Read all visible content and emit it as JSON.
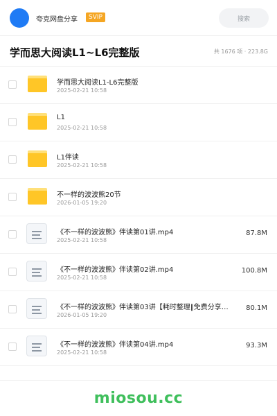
{
  "header": {
    "share_name": "夸克网盘分享",
    "badge": "SVIP",
    "search_label": "搜索",
    "avatar_color": "#1f7bf5",
    "badge_color": "#f5a623"
  },
  "title_bar": {
    "title": "学而思大阅读L1~L6完整版",
    "stats": "共 1676 项 · 223.8G"
  },
  "files": [
    {
      "type": "folder",
      "icon": "folder-icon",
      "name": "学而思大阅读L1-L6完整版",
      "date": "2025-02-21 10:58",
      "size": ""
    },
    {
      "type": "folder",
      "icon": "folder-icon",
      "name": "L1",
      "date": "2025-02-21 10:58",
      "size": ""
    },
    {
      "type": "folder",
      "icon": "folder-icon",
      "name": "L1伴读",
      "date": "2025-02-21 10:58",
      "size": ""
    },
    {
      "type": "folder",
      "icon": "folder-icon",
      "name": "不一样的波波熊20节",
      "date": "2026-01-05 19:20",
      "size": ""
    },
    {
      "type": "file",
      "icon": "document-icon",
      "name": "《不一样的波波熊》伴读第01讲.mp4",
      "date": "2025-02-21 10:58",
      "size": "87.8M"
    },
    {
      "type": "file",
      "icon": "document-icon",
      "name": "《不一样的波波熊》伴读第02讲.mp4",
      "date": "2025-02-21 10:58",
      "size": "100.8M"
    },
    {
      "type": "file",
      "icon": "document-icon",
      "name": "《不一样的波波熊》伴读第03讲【耗时整理‖免费分享…",
      "date": "2026-01-05 19:20",
      "size": "80.1M"
    },
    {
      "type": "file",
      "icon": "document-icon",
      "name": "《不一样的波波熊》伴读第04讲.mp4",
      "date": "2025-02-21 10:58",
      "size": "93.3M"
    }
  ],
  "watermark": "miosou.cc",
  "watermark_color": "#3fbf5c"
}
